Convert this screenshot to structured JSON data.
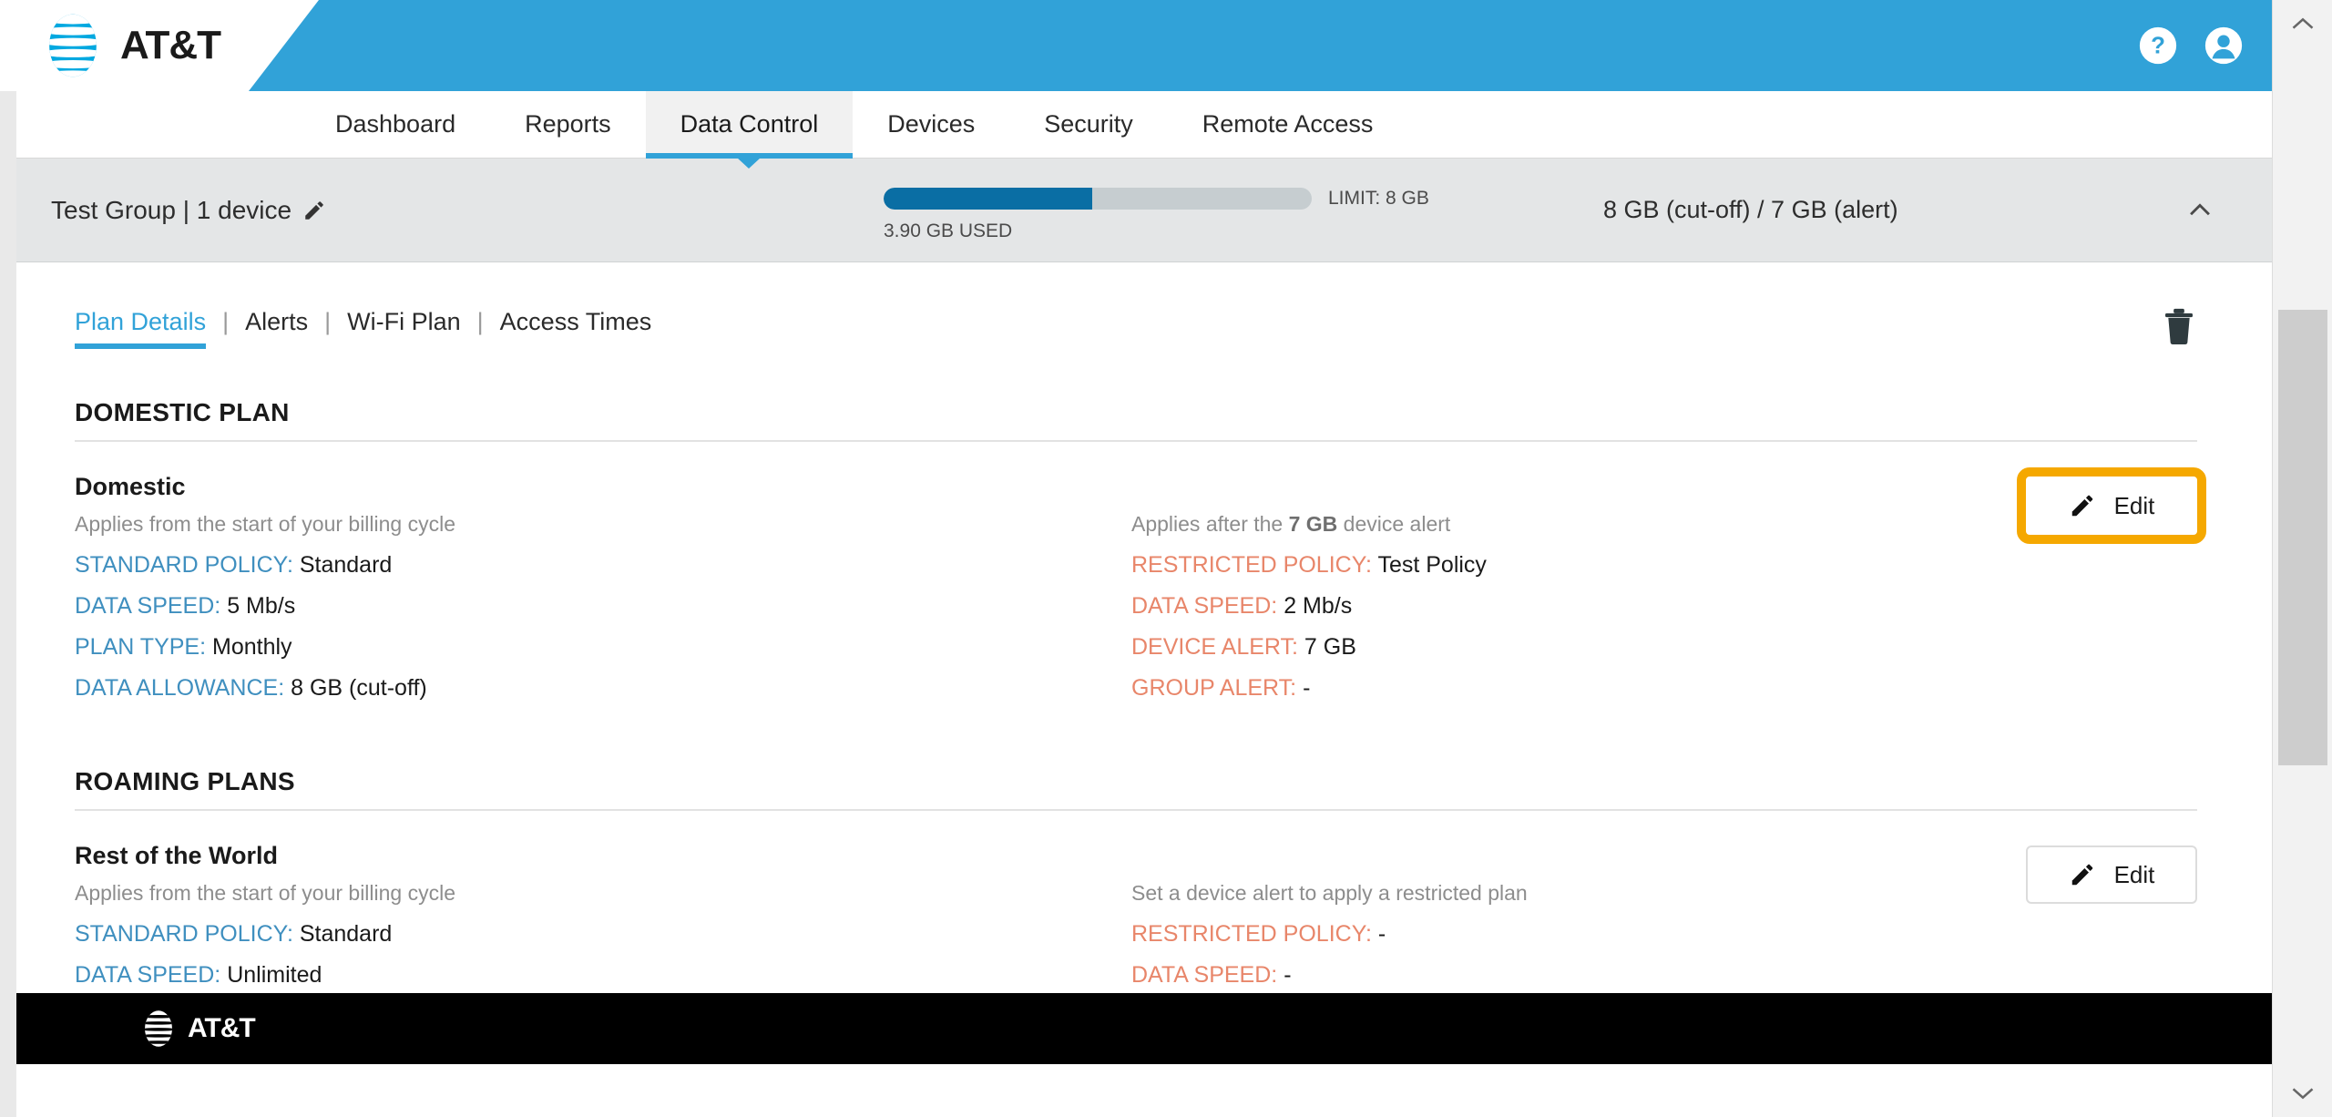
{
  "header": {
    "brand": "AT&T",
    "help_icon": "question-mark-circle-icon",
    "account_icon": "user-account-circle-icon",
    "nav": [
      {
        "label": "Dashboard",
        "active": false
      },
      {
        "label": "Reports",
        "active": false
      },
      {
        "label": "Data Control",
        "active": true
      },
      {
        "label": "Devices",
        "active": false
      },
      {
        "label": "Security",
        "active": false
      },
      {
        "label": "Remote Access",
        "active": false
      }
    ]
  },
  "group": {
    "name_and_count": "Test Group | 1 device",
    "edit_icon": "pencil-icon",
    "usage_used_label": "3.90 GB USED",
    "usage_limit_label": "LIMIT: 8 GB",
    "usage_percent": 48.75,
    "caps_label": "8 GB (cut-off) / 7 GB (alert)",
    "collapse_icon": "chevron-up-icon"
  },
  "subtabs": [
    {
      "label": "Plan Details",
      "active": true
    },
    {
      "label": "Alerts",
      "active": false
    },
    {
      "label": "Wi-Fi Plan",
      "active": false
    },
    {
      "label": "Access Times",
      "active": false
    }
  ],
  "separator": "|",
  "delete_icon": "trash-icon",
  "sections": [
    {
      "title": "DOMESTIC PLAN",
      "plan_name": "Domestic",
      "left_sub": "Applies from the start of your billing cycle",
      "right_sub_pre": "Applies after the ",
      "right_sub_bold": "7 GB",
      "right_sub_post": " device alert",
      "left_rows": [
        {
          "label": "STANDARD POLICY",
          "value": "Standard"
        },
        {
          "label": "DATA SPEED",
          "value": "5 Mb/s"
        },
        {
          "label": "PLAN TYPE",
          "value": "Monthly"
        },
        {
          "label": "DATA ALLOWANCE",
          "value": "8 GB (cut-off)"
        }
      ],
      "right_rows": [
        {
          "label": "RESTRICTED POLICY",
          "value": "Test Policy"
        },
        {
          "label": "DATA SPEED",
          "value": "2 Mb/s"
        },
        {
          "label": "DEVICE ALERT",
          "value": "7 GB"
        },
        {
          "label": "GROUP ALERT",
          "value": "-"
        }
      ],
      "edit_label": "Edit",
      "edit_icon": "pencil-icon",
      "edit_highlighted": true
    },
    {
      "title": "ROAMING PLANS",
      "plan_name": "Rest of the World",
      "left_sub": "Applies from the start of your billing cycle",
      "right_sub_pre": "Set a device alert to apply a restricted plan",
      "right_sub_bold": "",
      "right_sub_post": "",
      "left_rows": [
        {
          "label": "STANDARD POLICY",
          "value": "Standard"
        },
        {
          "label": "DATA SPEED",
          "value": "Unlimited"
        }
      ],
      "right_rows": [
        {
          "label": "RESTRICTED POLICY",
          "value": "-"
        },
        {
          "label": "DATA SPEED",
          "value": "-"
        }
      ],
      "edit_label": "Edit",
      "edit_icon": "pencil-icon",
      "edit_highlighted": false
    }
  ],
  "footer": {
    "brand": "AT&T"
  },
  "colors": {
    "brand_blue": "#31a2d8",
    "deep_blue": "#0a6ea4",
    "label_blue": "#3f8fbf",
    "label_orange": "#e8866a",
    "highlight_amber": "#f5a800",
    "group_bar_bg": "#e4e6e7",
    "footer_black": "#000000"
  },
  "scrollbar": {
    "up_icon": "chevron-up-icon",
    "down_icon": "chevron-down-icon"
  }
}
